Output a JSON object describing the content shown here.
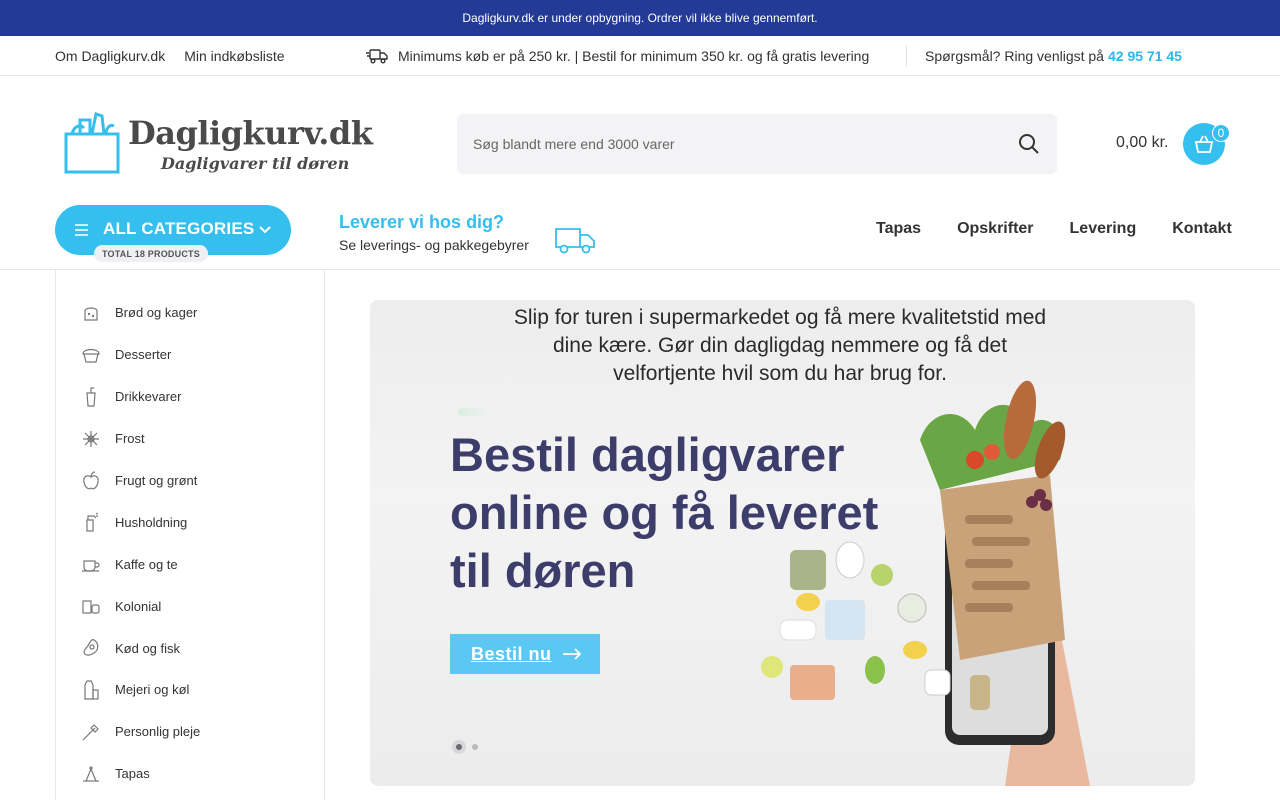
{
  "announcement": "Dagligkurv.dk er under opbygning. Ordrer vil ikke blive gennemført.",
  "infobar": {
    "links": [
      "Om Dagligkurv.dk",
      "Min indkøbsliste"
    ],
    "shipping_note": "Minimums køb er på 250 kr. | Bestil for minimum 350 kr. og få gratis levering",
    "phone_prefix": "Spørgsmål? Ring venligst på",
    "phone_number": "42 95 71 45"
  },
  "logo": {
    "brand": "Dagligkurv.dk",
    "tagline": "Dagligvarer til døren"
  },
  "search": {
    "placeholder": "Søg blandt mere end 3000 varer"
  },
  "cart": {
    "total": "0,00 kr.",
    "count": "0"
  },
  "categories_button": {
    "label": "ALL CATEGORIES",
    "badge": "TOTAL 18 PRODUCTS"
  },
  "delivery": {
    "question": "Leverer vi hos dig?",
    "subtitle": "Se leverings- og pakkegebyrer"
  },
  "main_nav": [
    "Tapas",
    "Opskrifter",
    "Levering",
    "Kontakt"
  ],
  "sidebar": {
    "items": [
      {
        "label": "Brød og kager",
        "icon": "bread-icon"
      },
      {
        "label": "Desserter",
        "icon": "cupcake-icon"
      },
      {
        "label": "Drikkevarer",
        "icon": "drink-icon"
      },
      {
        "label": "Frost",
        "icon": "snowflake-icon"
      },
      {
        "label": "Frugt og grønt",
        "icon": "apple-icon"
      },
      {
        "label": "Husholdning",
        "icon": "spray-bottle-icon"
      },
      {
        "label": "Kaffe og te",
        "icon": "coffee-cup-icon"
      },
      {
        "label": "Kolonial",
        "icon": "canned-food-icon"
      },
      {
        "label": "Kød og fisk",
        "icon": "meat-icon"
      },
      {
        "label": "Mejeri og køl",
        "icon": "milk-carton-icon"
      },
      {
        "label": "Personlig pleje",
        "icon": "toothbrush-icon"
      },
      {
        "label": "Tapas",
        "icon": "tapas-icon"
      }
    ]
  },
  "hero": {
    "intro": "Slip for turen i supermarkedet og få mere kvalitetstid med dine kære. Gør din dagligdag nemmere og få det velfortjente hvil som du har brug for.",
    "headline": "Bestil dagligvarer online og få leveret til døren",
    "cta": "Bestil nu",
    "slides": 2,
    "active_slide": 1
  },
  "colors": {
    "announcement_bg": "#233a96",
    "accent": "#34bfee",
    "headline": "#3d3d6b"
  }
}
